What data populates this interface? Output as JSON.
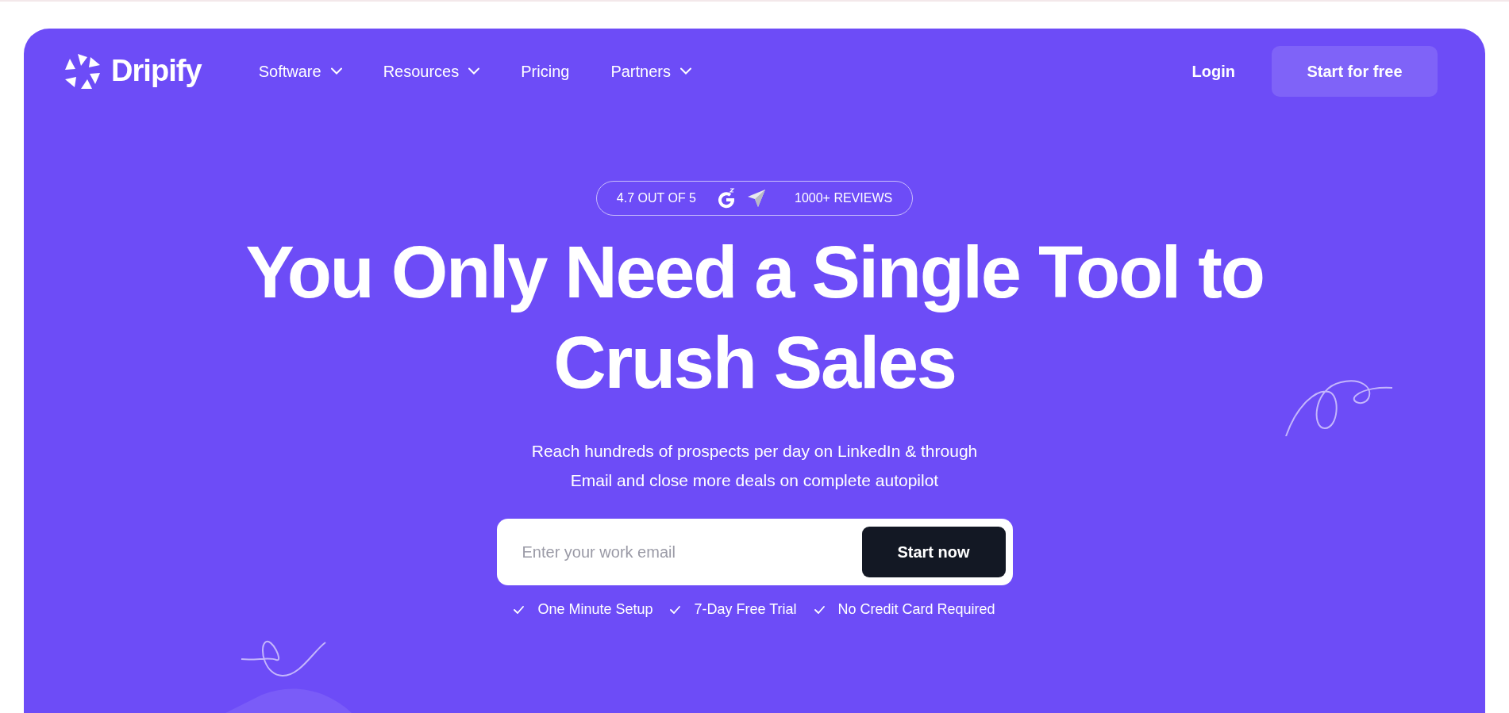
{
  "nav": {
    "brand": "Dripify",
    "items": [
      {
        "label": "Software",
        "dropdown": true
      },
      {
        "label": "Resources",
        "dropdown": true
      },
      {
        "label": "Pricing",
        "dropdown": false
      },
      {
        "label": "Partners",
        "dropdown": true
      }
    ],
    "login": "Login",
    "cta": "Start for free"
  },
  "rating": {
    "score": "4.7 OUT OF 5",
    "reviews": "1000+ REVIEWS"
  },
  "headline": [
    "You Only Need a Single Tool to",
    "Crush Sales"
  ],
  "subtitle": [
    "Reach hundreds of prospects per day on LinkedIn & through",
    "Email and close more deals on complete autopilot"
  ],
  "signup": {
    "placeholder": "Enter your work email",
    "button": "Start now"
  },
  "perks": [
    "One Minute Setup",
    "7-Day Free Trial",
    "No Credit Card Required"
  ]
}
